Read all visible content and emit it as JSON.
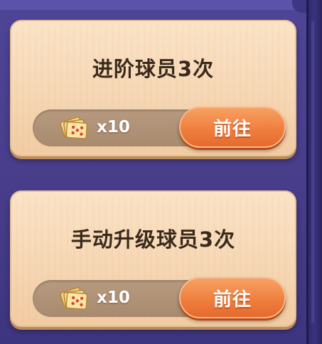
{
  "tasks": [
    {
      "title": "进阶球员3次",
      "reward": {
        "icon": "ticket-bundle-icon",
        "count": "x10"
      },
      "button_label": "前往"
    },
    {
      "title": "手动升级球员3次",
      "reward": {
        "icon": "ticket-bundle-icon",
        "count": "x10"
      },
      "button_label": "前往"
    }
  ],
  "colors": {
    "background": "#4a3f8c",
    "card": "#f6d7b4",
    "button": "#ef7f3e",
    "title_text": "#3a2a1c"
  }
}
